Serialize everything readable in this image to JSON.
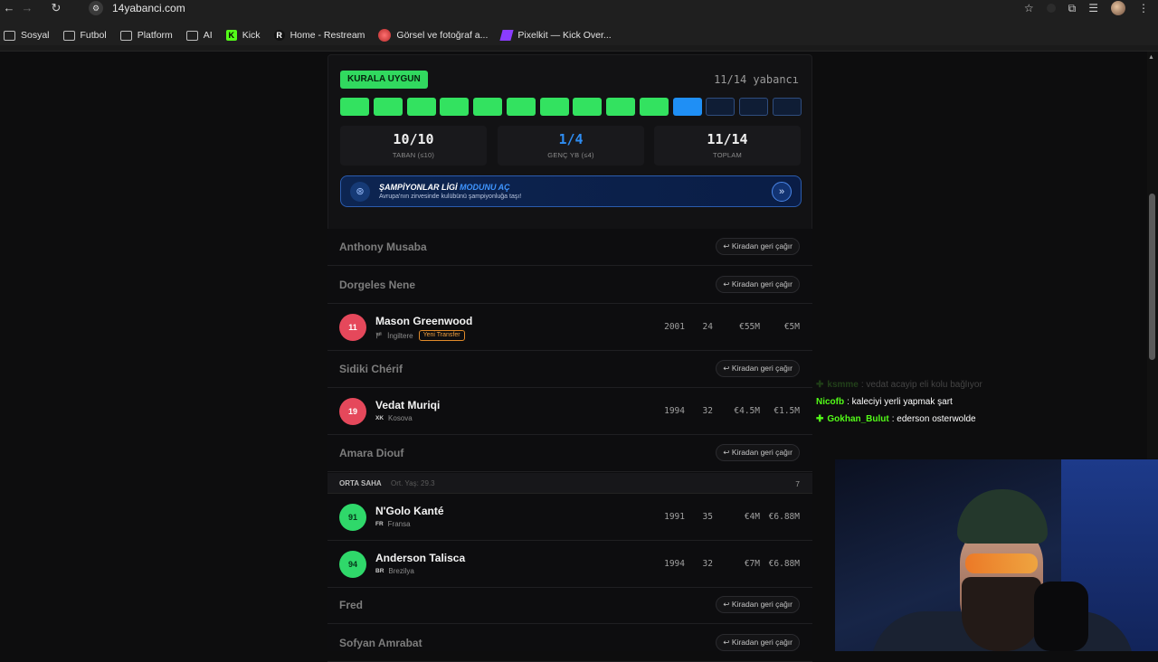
{
  "browser": {
    "url": "14yabanci.com",
    "bookmarks": [
      {
        "label": "Sosyal",
        "icon": "folder-icon"
      },
      {
        "label": "Futbol",
        "icon": "folder-icon"
      },
      {
        "label": "Platform",
        "icon": "folder-icon"
      },
      {
        "label": "AI",
        "icon": "folder-icon"
      },
      {
        "label": "Kick",
        "icon": "kick-icon"
      },
      {
        "label": "Home - Restream",
        "icon": "restream-icon"
      },
      {
        "label": "Görsel ve fotoğraf a...",
        "icon": "image-search-icon"
      },
      {
        "label": "Pixelkit — Kick Over...",
        "icon": "pixelkit-icon"
      }
    ]
  },
  "panel": {
    "eligible_badge": "KURALA UYGUN",
    "count": "11/14 yabancı",
    "slots": {
      "filled_base": 10,
      "filled_young": 1,
      "total": 14
    },
    "stats": [
      {
        "value": "10/10",
        "label": "TABAN (≤10)",
        "highlight": false
      },
      {
        "value": "1/4",
        "label": "GENÇ YB (≤4)",
        "highlight": true
      },
      {
        "value": "11/14",
        "label": "TOPLAM",
        "highlight": false
      }
    ],
    "champions": {
      "title_a": "ŞAMPİYONLAR LİGİ ",
      "title_b": "MODUNU AÇ",
      "subtitle": "Avrupa'nın zirvesinde kulübünü şampiyonluğa taşı!"
    }
  },
  "list": {
    "loan_button": "↩ Kiradan geri çağır",
    "rows": [
      {
        "type": "loan",
        "name": "Anthony Musaba"
      },
      {
        "type": "loan",
        "name": "Dorgeles Nene"
      },
      {
        "type": "player",
        "number": "11",
        "color": "red",
        "name": "Mason Greenwood",
        "cc": "🏴",
        "nation": "İngiltere",
        "tag": "Yeni Transfer",
        "year": "2001",
        "age": "24",
        "value": "€55M",
        "wage": "€5M"
      },
      {
        "type": "loan",
        "name": "Sidiki Chérif"
      },
      {
        "type": "player",
        "number": "19",
        "color": "red",
        "name": "Vedat Muriqi",
        "cc": "XK",
        "nation": "Kosova",
        "tag": "",
        "year": "1994",
        "age": "32",
        "value": "€4.5M",
        "wage": "€1.5M"
      },
      {
        "type": "loan",
        "name": "Amara Diouf"
      },
      {
        "type": "section",
        "name": "ORTA SAHA",
        "sub": "Ort. Yaş: 29.3",
        "count": "7"
      },
      {
        "type": "player",
        "number": "91",
        "color": "green",
        "name": "N'Golo Kanté",
        "cc": "FR",
        "nation": "Fransa",
        "tag": "",
        "year": "1991",
        "age": "35",
        "value": "€4M",
        "wage": "€6.88M"
      },
      {
        "type": "player",
        "number": "94",
        "color": "green",
        "name": "Anderson Talisca",
        "cc": "BR",
        "nation": "Brezilya",
        "tag": "",
        "year": "1994",
        "age": "32",
        "value": "€7M",
        "wage": "€6.88M"
      },
      {
        "type": "loan",
        "name": "Fred"
      },
      {
        "type": "loan",
        "name": "Sofyan Amrabat"
      }
    ]
  },
  "chat": [
    {
      "user": "ksmme",
      "text": ": vedat acayip eli kolu bağlıyor",
      "dim": true,
      "plus": true
    },
    {
      "user": "Nicofb",
      "text": ": kaleciyi yerli yapmak şart",
      "dim": false,
      "plus": false
    },
    {
      "user": "Gokhan_Bulut",
      "text": ": ederson osterwolde",
      "dim": false,
      "plus": true
    }
  ]
}
